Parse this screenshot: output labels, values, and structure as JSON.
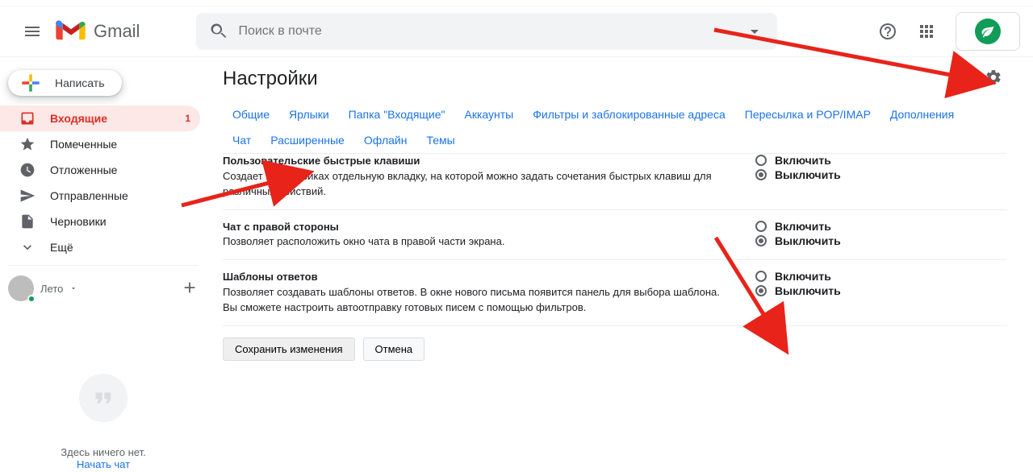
{
  "header": {
    "product": "Gmail",
    "search_placeholder": "Поиск в почте"
  },
  "sidebar": {
    "compose": "Написать",
    "items": [
      {
        "label": "Входящие",
        "count": "1"
      },
      {
        "label": "Помеченные"
      },
      {
        "label": "Отложенные"
      },
      {
        "label": "Отправленные"
      },
      {
        "label": "Черновики"
      },
      {
        "label": "Ещё"
      }
    ],
    "chat_user": "Лето",
    "empty_title": "Здесь ничего нет.",
    "empty_action": "Начать чат"
  },
  "settings": {
    "title": "Настройки",
    "tabs_row1": [
      "Общие",
      "Ярлыки",
      "Папка \"Входящие\"",
      "Аккаунты",
      "Фильтры и заблокированные адреса",
      "Пересылка и POP/IMAP",
      "Дополнения"
    ],
    "tabs_row2": [
      "Чат",
      "Расширенные",
      "Офлайн",
      "Темы"
    ],
    "active_tab": "Расширенные",
    "options": {
      "enable": "Включить",
      "disable": "Выключить"
    },
    "rows": [
      {
        "title": "Пользовательские быстрые клавиши",
        "desc": "Создает в настройках отдельную вкладку, на которой можно задать сочетания быстрых клавиш для различных действий.",
        "checked": "disable"
      },
      {
        "title": "Чат с правой стороны",
        "desc": "Позволяет расположить окно чата в правой части экрана.",
        "checked": "disable"
      },
      {
        "title": "Шаблоны ответов",
        "desc": "Позволяет создавать шаблоны ответов. В окне нового письма появится панель для выбора шаблона. Вы сможете настроить автоотправку готовых писем с помощью фильтров.",
        "checked": "disable"
      }
    ],
    "save": "Сохранить изменения",
    "cancel": "Отмена"
  }
}
